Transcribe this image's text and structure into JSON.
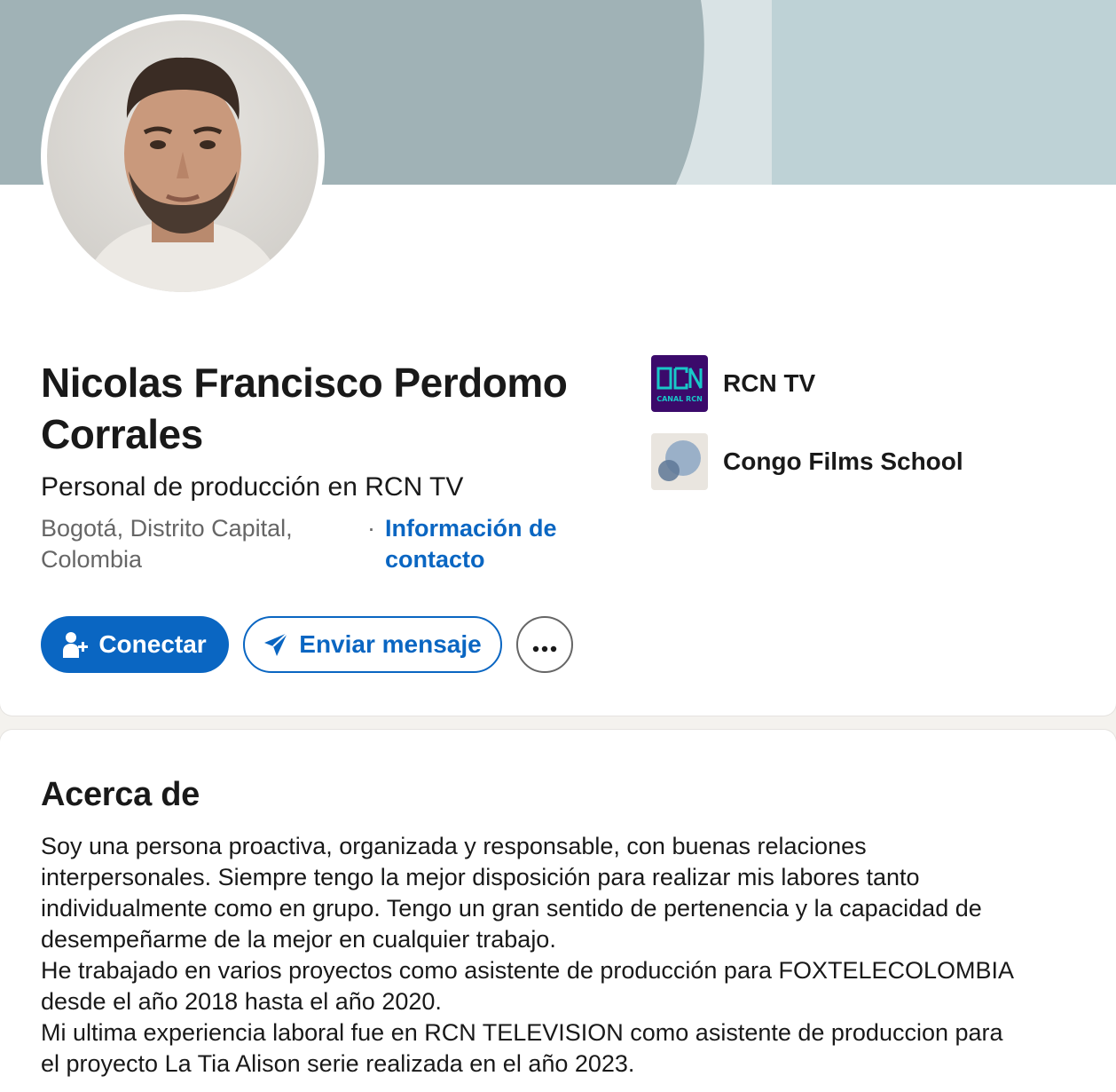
{
  "profile": {
    "name": "Nicolas Francisco Perdomo Corrales",
    "headline": "Personal de producción en RCN TV",
    "location": "Bogotá, Distrito Capital, Colombia",
    "contact_separator": "·",
    "contact_link": "Información de contacto"
  },
  "actions": {
    "connect_label": "Conectar",
    "message_label": "Enviar mensaje",
    "more_label": "•••"
  },
  "organizations": [
    {
      "name": "RCN TV",
      "logo_text": "CANAL RCN",
      "logo_mark": "RCN"
    },
    {
      "name": "Congo Films School"
    }
  ],
  "about": {
    "title": "Acerca de",
    "lines": [
      "Soy una persona proactiva, organizada y responsable, con buenas relaciones",
      "interpersonales. Siempre tengo la mejor disposición para realizar mis labores tanto",
      "individualmente como en grupo. Tengo un gran sentido de pertenencia y la capacidad de",
      "desempeñarme de la mejor en cualquier trabajo.",
      "He trabajado en varios proyectos como asistente de producción para FOXTELECOLOMBIA",
      "desde el año 2018 hasta el año 2020.",
      "Mi ultima experiencia laboral fue en RCN TELEVISION como asistente de produccion para",
      "el proyecto La Tia Alison serie realizada en el año 2023."
    ]
  },
  "colors": {
    "brand_blue": "#0a66c2",
    "banner_main": "#a0b2b6",
    "banner_light": "#d9e3e5",
    "banner_right": "#bed2d6",
    "rcn_purple": "#3b0a6b",
    "rcn_teal": "#18c8c8"
  },
  "icons": [
    "add-person-icon",
    "send-icon",
    "more-icon"
  ]
}
